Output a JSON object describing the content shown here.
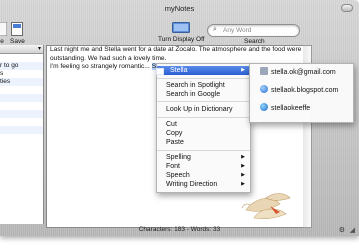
{
  "window": {
    "title": "myNotes"
  },
  "toolbar": {
    "save_label": "Save",
    "turn_display_label": "Turn Display Off",
    "search_label": "Search",
    "search_placeholder": "Any Word",
    "left_partial_label": "e"
  },
  "sidebar": {
    "items": [
      {
        "label": ""
      },
      {
        "label": "r to go"
      },
      {
        "label": "s"
      },
      {
        "label": "ties"
      },
      {
        "label": ""
      },
      {
        "label": ""
      },
      {
        "label": ""
      },
      {
        "label": ""
      },
      {
        "label": ""
      },
      {
        "label": ""
      },
      {
        "label": ""
      }
    ]
  },
  "editor": {
    "line1": "Last night me and Stella went for a date at Zocalo. The atmosphere and the food were",
    "line2": "outstanding. We had such a lovely time.",
    "line3_prefix": "I'm feeling so strangely romantic... ",
    "line3_highlight": "Stella"
  },
  "context_menu": {
    "header": "Stella",
    "items": [
      {
        "label": "Search in Spotlight"
      },
      {
        "label": "Search in Google"
      },
      {
        "label": "Look Up in Dictionary"
      },
      {
        "label": "Cut"
      },
      {
        "label": "Copy"
      },
      {
        "label": "Paste"
      },
      {
        "label": "Spelling"
      },
      {
        "label": "Font"
      },
      {
        "label": "Speech"
      },
      {
        "label": "Writing Direction"
      }
    ]
  },
  "submenu": {
    "items": [
      {
        "label": "stella.ok@gmail.com",
        "icon": "mail-icon"
      },
      {
        "label": "stellaok.blogspot.com",
        "icon": "globe-icon"
      },
      {
        "label": "stellaokeeffe",
        "icon": "chat-icon"
      }
    ]
  },
  "status": {
    "text": "Characters: 183 - Words: 33"
  },
  "colors": {
    "highlight": "#b5d5ff",
    "menu_active": "#2a5fd4"
  }
}
